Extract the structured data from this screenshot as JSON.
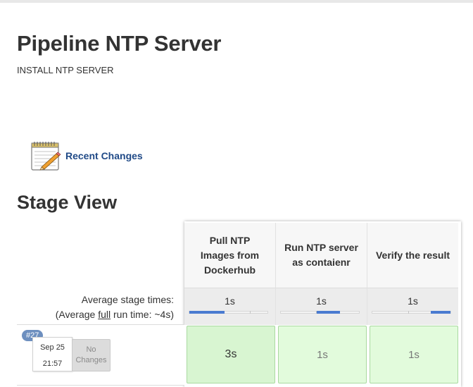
{
  "header": {
    "title": "Pipeline NTP Server",
    "description": "INSTALL NTP SERVER"
  },
  "recent_changes": {
    "icon": "notepad-icon",
    "label": "Recent Changes"
  },
  "stage_view": {
    "title": "Stage View",
    "average_label_line1": "Average stage times:",
    "average_label_prefix": "(Average ",
    "average_label_link": "full",
    "average_label_suffix": " run time: ~4s)",
    "stages": [
      {
        "name": "Pull NTP Images from Dockerhub",
        "avg_time": "1s",
        "bar_fraction": 0.45
      },
      {
        "name": "Run NTP server as contaienr",
        "avg_time": "1s",
        "bar_fraction": 0.3
      },
      {
        "name": "Verify the result",
        "avg_time": "1s",
        "bar_fraction": 0.25
      }
    ],
    "runs": [
      {
        "number": "#27",
        "date": "Sep 25",
        "time": "21:57",
        "changes": "No Changes",
        "stage_times": [
          "3s",
          "1s",
          "1s"
        ]
      }
    ]
  },
  "colors": {
    "link": "#204a87",
    "success_cell": "#dff7da",
    "progress_bar": "#4a7bd0",
    "badge": "#6d8fbf"
  }
}
